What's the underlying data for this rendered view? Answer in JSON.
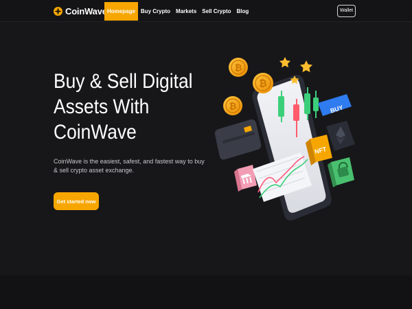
{
  "brand": {
    "name": "CoinWave",
    "icon": "coinwave-logo-icon",
    "accent_color": "#f7a600"
  },
  "nav": {
    "items": [
      {
        "label": "Homepage",
        "active": true
      },
      {
        "label": "Buy Crypto",
        "active": false
      },
      {
        "label": "Markets",
        "active": false
      },
      {
        "label": "Sell Crypto",
        "active": false
      },
      {
        "label": "Blog",
        "active": false
      }
    ],
    "wallet_label": "Wallet"
  },
  "hero": {
    "title_lines": [
      "Buy & Sell Digital",
      "Assets With",
      "CoinWave"
    ],
    "description": "CoinWave is the easiest, safest, and fastest way to buy & sell crypto asset exchange.",
    "cta_label": "Get started now"
  },
  "illustration": {
    "buy_tag": "BUY",
    "nft_tag": "NFT",
    "icons": [
      "bitcoin-coin-icon",
      "star-icon",
      "candlestick-chart-icon",
      "credit-card-icon",
      "ethereum-icon",
      "padlock-icon",
      "bank-icon",
      "line-chart-icon"
    ]
  },
  "colors": {
    "background": "#17171a",
    "accent": "#f7a600",
    "buy_tag": "#2f7bf0"
  }
}
